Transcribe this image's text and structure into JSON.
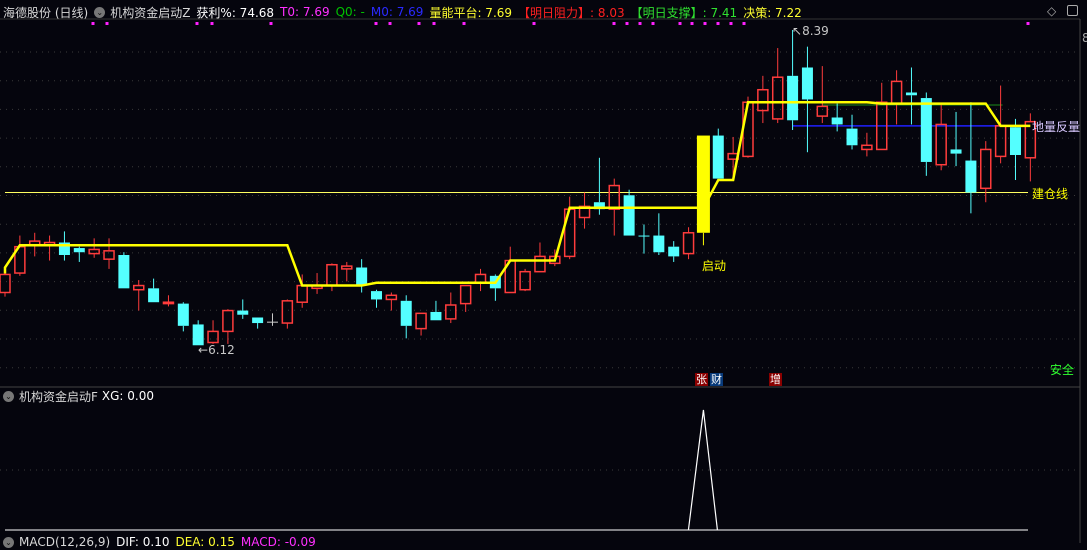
{
  "header": {
    "stock": "海德股份 (日线)",
    "indicator": "机构资金启动Z",
    "profit": "获利%: 74.68",
    "t0": "T0: 7.69",
    "q0": "Q0: -",
    "m0": "M0: 7.69",
    "volume_platform": "量能平台: 7.69",
    "resistance": "【明日阻力】: 8.03",
    "support": "【明日支撑】: 7.41",
    "decision": "决策: 7.22"
  },
  "colors": {
    "up": "#ff3c3c",
    "down": "#54ffff",
    "signal": "#ffff00",
    "background": "#05050d",
    "support_line": "#2020ff",
    "guide_line": "#1a8a1a"
  },
  "main_labels": {
    "high_label": "8.39",
    "low_label": "6.12",
    "start_label": "启动",
    "safe_label": "安全",
    "build_line_label": "建仓线",
    "low_volume_label": "地量反量",
    "tag_zhang": "张",
    "tag_cai": "财",
    "tag_zeng": "增",
    "axis_partial": "8"
  },
  "lower_panel": {
    "title": "机构资金启动F",
    "xg": "XG: 0.00"
  },
  "macd_panel": {
    "title": "MACD(12,26,9)",
    "dif": "DIF: 0.10",
    "dea": "DEA: 0.15",
    "macd": "MACD: -0.09"
  },
  "chart_data": {
    "type": "candlestick",
    "price_range": [
      6.12,
      8.39
    ],
    "build_line": 7.22,
    "support_line": 7.7,
    "guide_line": 7.85,
    "signal_candle_index": 47,
    "candles": [
      [
        6.5,
        6.63,
        6.65,
        6.47
      ],
      [
        6.64,
        6.83,
        6.91,
        6.62
      ],
      [
        6.84,
        6.87,
        6.93,
        6.76
      ],
      [
        6.84,
        6.86,
        6.91,
        6.73
      ],
      [
        6.86,
        6.77,
        6.94,
        6.73
      ],
      [
        6.82,
        6.79,
        6.83,
        6.72
      ],
      [
        6.78,
        6.81,
        6.89,
        6.75
      ],
      [
        6.74,
        6.8,
        6.89,
        6.67
      ],
      [
        6.77,
        6.53,
        6.79,
        6.53
      ],
      [
        6.52,
        6.55,
        6.59,
        6.37
      ],
      [
        6.53,
        6.43,
        6.6,
        6.43
      ],
      [
        6.42,
        6.43,
        6.48,
        6.4
      ],
      [
        6.42,
        6.26,
        6.43,
        6.22
      ],
      [
        6.27,
        6.12,
        6.3,
        6.12
      ],
      [
        6.14,
        6.22,
        6.3,
        6.13
      ],
      [
        6.22,
        6.37,
        6.38,
        6.13
      ],
      [
        6.37,
        6.34,
        6.45,
        6.31
      ],
      [
        6.32,
        6.28,
        6.32,
        6.24
      ],
      [
        6.29,
        6.29,
        6.35,
        6.26
      ],
      [
        6.28,
        6.44,
        6.45,
        6.24
      ],
      [
        6.43,
        6.55,
        6.63,
        6.39
      ],
      [
        6.53,
        6.55,
        6.64,
        6.49
      ],
      [
        6.55,
        6.7,
        6.71,
        6.51
      ],
      [
        6.67,
        6.69,
        6.72,
        6.58
      ],
      [
        6.68,
        6.55,
        6.74,
        6.5
      ],
      [
        6.51,
        6.45,
        6.52,
        6.39
      ],
      [
        6.45,
        6.48,
        6.5,
        6.37
      ],
      [
        6.44,
        6.26,
        6.48,
        6.17
      ],
      [
        6.24,
        6.35,
        6.35,
        6.19
      ],
      [
        6.36,
        6.3,
        6.44,
        6.3
      ],
      [
        6.31,
        6.41,
        6.5,
        6.28
      ],
      [
        6.42,
        6.55,
        6.55,
        6.36
      ],
      [
        6.57,
        6.63,
        6.67,
        6.51
      ],
      [
        6.62,
        6.53,
        6.63,
        6.44
      ],
      [
        6.5,
        6.73,
        6.83,
        6.5
      ],
      [
        6.52,
        6.65,
        6.67,
        6.51
      ],
      [
        6.65,
        6.76,
        6.86,
        6.65
      ],
      [
        6.71,
        6.76,
        6.81,
        6.69
      ],
      [
        6.76,
        7.1,
        7.19,
        6.74
      ],
      [
        7.04,
        7.12,
        7.22,
        6.96
      ],
      [
        7.15,
        7.1,
        7.47,
        7.06
      ],
      [
        7.1,
        7.27,
        7.32,
        6.91
      ],
      [
        7.2,
        6.91,
        7.24,
        6.91
      ],
      [
        6.91,
        6.91,
        6.99,
        6.78
      ],
      [
        6.91,
        6.79,
        7.07,
        6.77
      ],
      [
        6.83,
        6.76,
        6.87,
        6.72
      ],
      [
        6.78,
        6.93,
        6.97,
        6.74
      ],
      [
        6.93,
        7.63,
        7.63,
        6.84
      ],
      [
        7.63,
        7.32,
        7.68,
        7.32
      ],
      [
        7.46,
        7.5,
        7.62,
        7.33
      ],
      [
        7.48,
        7.87,
        7.91,
        7.47
      ],
      [
        7.81,
        7.96,
        8.06,
        7.72
      ],
      [
        7.75,
        8.05,
        8.26,
        7.72
      ],
      [
        8.06,
        7.74,
        8.39,
        7.67
      ],
      [
        8.12,
        7.89,
        8.27,
        7.51
      ],
      [
        7.77,
        7.84,
        8.13,
        7.72
      ],
      [
        7.76,
        7.71,
        7.86,
        7.66
      ],
      [
        7.68,
        7.56,
        7.78,
        7.53
      ],
      [
        7.53,
        7.56,
        7.65,
        7.48
      ],
      [
        7.53,
        7.87,
        8.01,
        7.53
      ],
      [
        7.86,
        8.02,
        8.1,
        7.71
      ],
      [
        7.94,
        7.92,
        8.12,
        7.71
      ],
      [
        7.9,
        7.44,
        7.94,
        7.34
      ],
      [
        7.42,
        7.71,
        7.86,
        7.38
      ],
      [
        7.53,
        7.5,
        7.8,
        7.41
      ],
      [
        7.45,
        7.22,
        7.87,
        7.07
      ],
      [
        7.25,
        7.53,
        7.59,
        7.15
      ],
      [
        7.48,
        7.7,
        7.99,
        7.43
      ],
      [
        7.69,
        7.49,
        7.75,
        7.31
      ],
      [
        7.47,
        7.73,
        7.79,
        7.3
      ]
    ],
    "platform_line": [
      6.68,
      6.84,
      6.84,
      6.84,
      6.84,
      6.84,
      6.84,
      6.84,
      6.84,
      6.84,
      6.84,
      6.84,
      6.84,
      6.84,
      6.84,
      6.84,
      6.84,
      6.84,
      6.84,
      6.84,
      6.55,
      6.55,
      6.55,
      6.55,
      6.55,
      6.57,
      6.57,
      6.57,
      6.57,
      6.57,
      6.57,
      6.57,
      6.57,
      6.57,
      6.73,
      6.73,
      6.73,
      6.73,
      7.11,
      7.11,
      7.11,
      7.11,
      7.11,
      7.11,
      7.11,
      7.11,
      7.11,
      7.11,
      7.31,
      7.31,
      7.87,
      7.87,
      7.87,
      7.87,
      7.87,
      7.87,
      7.87,
      7.87,
      7.87,
      7.86,
      7.86,
      7.86,
      7.86,
      7.86,
      7.86,
      7.86,
      7.86,
      7.7,
      7.7,
      7.7
    ],
    "xg_values_nonzero": {
      "index": 47,
      "value": 1
    }
  }
}
